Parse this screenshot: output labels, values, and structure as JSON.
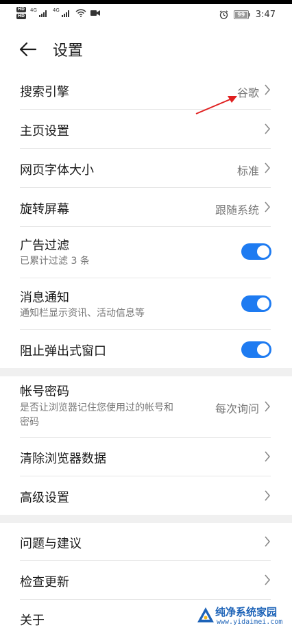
{
  "status": {
    "net_a": "4G",
    "net_b": "4G",
    "hd_a": "HD",
    "hd_b": "HD",
    "battery": "99",
    "time": "3:47"
  },
  "header": {
    "title": "设置"
  },
  "rows": {
    "search_engine": {
      "label": "搜索引擎",
      "value": "谷歌"
    },
    "homepage": {
      "label": "主页设置"
    },
    "font_size": {
      "label": "网页字体大小",
      "value": "标准"
    },
    "rotation": {
      "label": "旋转屏幕",
      "value": "跟随系统"
    },
    "ad_filter": {
      "label": "广告过滤",
      "sub": "已累计过滤 3 条",
      "on": true
    },
    "notifications": {
      "label": "消息通知",
      "sub": "通知栏显示资讯、活动信息等",
      "on": true
    },
    "block_popups": {
      "label": "阻止弹出式窗口",
      "on": true
    },
    "passwords": {
      "label": "帐号密码",
      "sub": "是否让浏览器记住您使用过的帐号和\n密码",
      "value": "每次询问"
    },
    "clear_data": {
      "label": "清除浏览器数据"
    },
    "advanced": {
      "label": "高级设置"
    },
    "feedback": {
      "label": "问题与建议"
    },
    "updates": {
      "label": "检查更新"
    },
    "about": {
      "label": "关于"
    }
  },
  "colors": {
    "toggle_on": "#1e7bf1",
    "annotation": "#e02020",
    "section_gap": "#f0f0f0"
  },
  "watermark": {
    "text": "纯净系统家园",
    "url": "www.yidaimei.com"
  }
}
